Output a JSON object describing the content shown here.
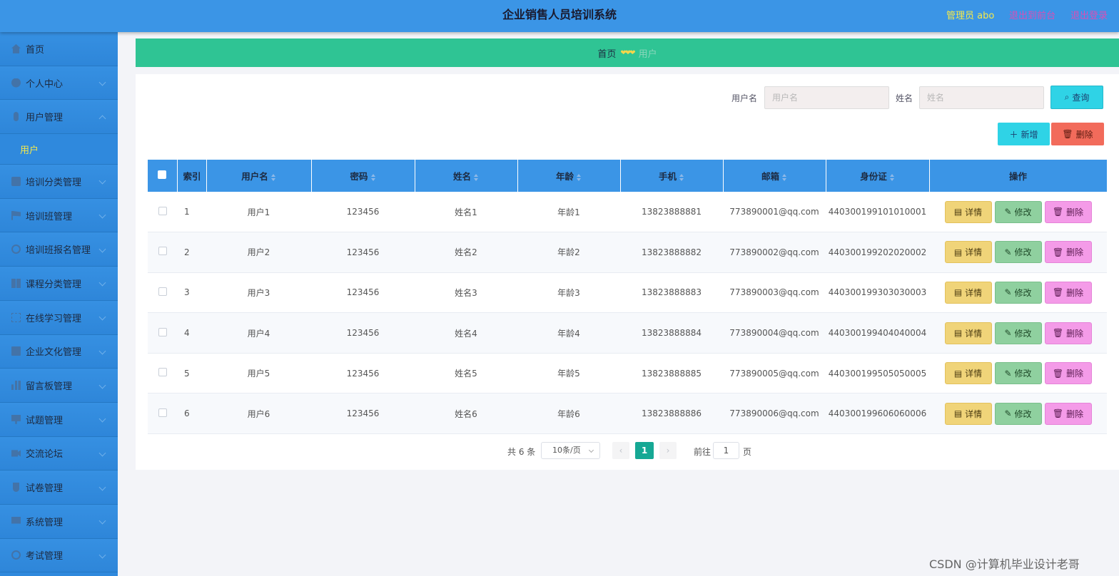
{
  "header": {
    "title": "企业销售人员培训系统",
    "admin_prefix": "管理员",
    "admin_name": "abo",
    "back_front": "退出到前台",
    "logout": "退出登录"
  },
  "sidebar": {
    "items": [
      {
        "label": "首页",
        "icon": "house-icon"
      },
      {
        "label": "个人中心",
        "icon": "user-icon"
      },
      {
        "label": "用户管理",
        "icon": "mic-icon",
        "expanded": true
      },
      {
        "label": "培训分类管理",
        "icon": "bag-icon"
      },
      {
        "label": "培训班管理",
        "icon": "flag-icon"
      },
      {
        "label": "培训班报名管理",
        "icon": "clock-icon"
      },
      {
        "label": "课程分类管理",
        "icon": "grid-icon"
      },
      {
        "label": "在线学习管理",
        "icon": "frame-icon"
      },
      {
        "label": "企业文化管理",
        "icon": "clipboard-icon"
      },
      {
        "label": "留言板管理",
        "icon": "bars-icon"
      },
      {
        "label": "试题管理",
        "icon": "monitor-icon"
      },
      {
        "label": "交流论坛",
        "icon": "video-icon"
      },
      {
        "label": "试卷管理",
        "icon": "cup-icon"
      },
      {
        "label": "系统管理",
        "icon": "screen-icon"
      },
      {
        "label": "考试管理",
        "icon": "globe-icon"
      }
    ],
    "submenu": "用户"
  },
  "breadcrumb": {
    "home": "首页",
    "separator": "❤❤❤",
    "current": "用户"
  },
  "search": {
    "username_label": "用户名",
    "username_placeholder": "用户名",
    "name_label": "姓名",
    "name_placeholder": "姓名",
    "query": "查询"
  },
  "actions": {
    "add": "新增",
    "delete": "删除"
  },
  "table": {
    "columns": [
      "索引",
      "用户名",
      "密码",
      "姓名",
      "年龄",
      "手机",
      "邮箱",
      "身份证",
      "操作"
    ],
    "rows": [
      {
        "index": "1",
        "username": "用户1",
        "password": "123456",
        "name": "姓名1",
        "age": "年龄1",
        "phone": "13823888881",
        "email": "773890001@qq.com",
        "id_card": "440300199101010001"
      },
      {
        "index": "2",
        "username": "用户2",
        "password": "123456",
        "name": "姓名2",
        "age": "年龄2",
        "phone": "13823888882",
        "email": "773890002@qq.com",
        "id_card": "440300199202020002"
      },
      {
        "index": "3",
        "username": "用户3",
        "password": "123456",
        "name": "姓名3",
        "age": "年龄3",
        "phone": "13823888883",
        "email": "773890003@qq.com",
        "id_card": "440300199303030003"
      },
      {
        "index": "4",
        "username": "用户4",
        "password": "123456",
        "name": "姓名4",
        "age": "年龄4",
        "phone": "13823888884",
        "email": "773890004@qq.com",
        "id_card": "440300199404040004"
      },
      {
        "index": "5",
        "username": "用户5",
        "password": "123456",
        "name": "姓名5",
        "age": "年龄5",
        "phone": "13823888885",
        "email": "773890005@qq.com",
        "id_card": "440300199505050005"
      },
      {
        "index": "6",
        "username": "用户6",
        "password": "123456",
        "name": "姓名6",
        "age": "年龄6",
        "phone": "13823888886",
        "email": "773890006@qq.com",
        "id_card": "440300199606060006"
      }
    ],
    "ops": {
      "detail": "详情",
      "edit": "修改",
      "remove": "删除"
    }
  },
  "pager": {
    "total": "共 6 条",
    "page_size": "10条/页",
    "current_page": "1",
    "goto_label": "前往",
    "goto_value": "1",
    "page_unit": "页"
  },
  "watermark": "CSDN @计算机毕业设计老哥",
  "colors": {
    "header": "#3b95e6",
    "sidebar": "#2f89dd",
    "breadcrumb": "#2fc494",
    "query": "#2fd3e6",
    "delete": "#f26b5b",
    "detail": "#f0d479",
    "edit": "#8fd09f",
    "remove": "#f49be8",
    "page_active": "#16a894"
  }
}
